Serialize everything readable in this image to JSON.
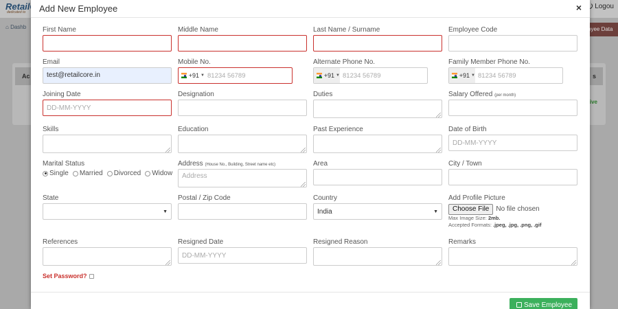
{
  "app": {
    "logo": "RetailC",
    "logo_sub": "dedicated to",
    "logout": "Logou",
    "breadcrumb": "Dashb",
    "header_button": "oyee Data",
    "panel_left": "Ac",
    "panel_right": "s",
    "status_text": "ctive"
  },
  "modal": {
    "title": "Add New Employee",
    "close": "×",
    "fields": {
      "first_name": {
        "label": "First Name",
        "value": ""
      },
      "middle_name": {
        "label": "Middle Name",
        "value": ""
      },
      "last_name": {
        "label": "Last Name / Surname",
        "value": ""
      },
      "employee_code": {
        "label": "Employee Code",
        "value": ""
      },
      "email": {
        "label": "Email",
        "value": "test@retailcore.in"
      },
      "mobile": {
        "label": "Mobile No.",
        "dial": "+91",
        "placeholder": "81234 56789"
      },
      "alt_phone": {
        "label": "Alternate Phone No.",
        "dial": "+91",
        "placeholder": "81234 56789"
      },
      "family_phone": {
        "label": "Family Member Phone No.",
        "dial": "+91",
        "placeholder": "81234 56789"
      },
      "joining_date": {
        "label": "Joining Date",
        "placeholder": "DD-MM-YYYY"
      },
      "designation": {
        "label": "Designation",
        "value": ""
      },
      "duties": {
        "label": "Duties",
        "value": ""
      },
      "salary": {
        "label": "Salary Offered",
        "label_note": "(per month)",
        "value": ""
      },
      "skills": {
        "label": "Skills",
        "value": ""
      },
      "education": {
        "label": "Education",
        "value": ""
      },
      "past_experience": {
        "label": "Past Experience",
        "value": ""
      },
      "dob": {
        "label": "Date of Birth",
        "placeholder": "DD-MM-YYYY"
      },
      "marital": {
        "label": "Marital Status",
        "options": [
          "Single",
          "Married",
          "Divorced",
          "Widow"
        ],
        "selected": "Single"
      },
      "address": {
        "label": "Address",
        "label_note": "(House No., Building, Street name etc)",
        "placeholder": "Address"
      },
      "area": {
        "label": "Area",
        "value": ""
      },
      "city": {
        "label": "City / Town",
        "value": ""
      },
      "state": {
        "label": "State",
        "value": ""
      },
      "postal": {
        "label": "Postal / Zip Code",
        "value": ""
      },
      "country": {
        "label": "Country",
        "value": "India"
      },
      "profile_picture": {
        "label": "Add Profile Picture",
        "button": "Choose File",
        "status": "No file chosen",
        "max_size_label": "Max Image Size:",
        "max_size_value": "2mb.",
        "formats_label": "Accepted Formats:",
        "formats_value": ".jpeg, .jpg, .png, .gif"
      },
      "references": {
        "label": "References",
        "value": ""
      },
      "resigned_date": {
        "label": "Resigned Date",
        "placeholder": "DD-MM-YYYY"
      },
      "resigned_reason": {
        "label": "Resigned Reason",
        "value": ""
      },
      "remarks": {
        "label": "Remarks",
        "value": ""
      }
    },
    "set_password": "Set Password?",
    "save_button": "Save Employee"
  },
  "colors": {
    "error": "#c9302c",
    "save": "#3cb05c"
  }
}
